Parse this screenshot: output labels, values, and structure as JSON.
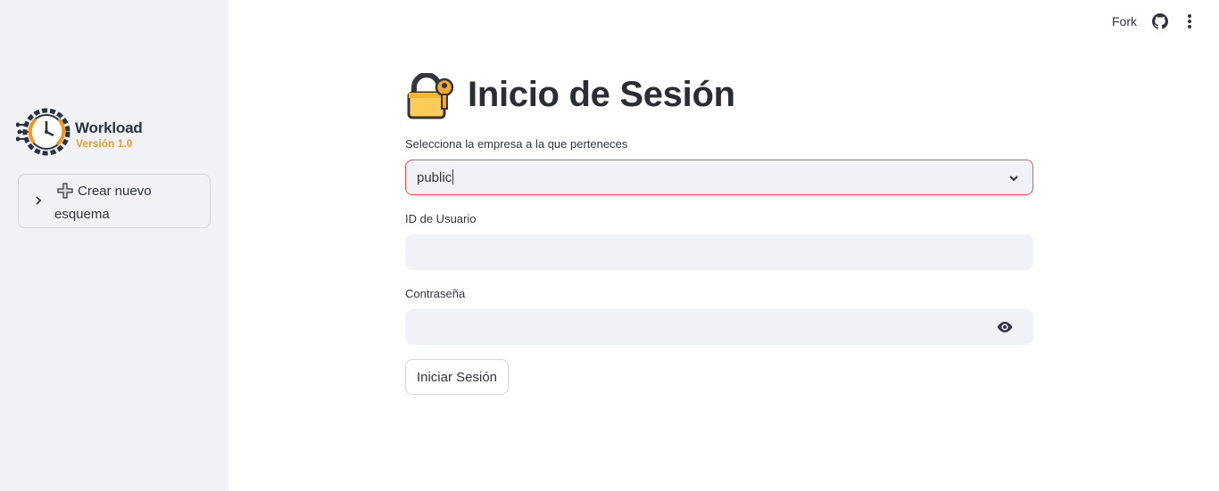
{
  "header": {
    "fork_label": "Fork",
    "github_icon": "github-icon",
    "menu_icon": "more-vertical-icon"
  },
  "sidebar": {
    "logo": {
      "title": "Workload",
      "subtitle": "Versión 1.0",
      "icon": "clock-gear-icon"
    },
    "expander": {
      "label": "Crear nuevo esquema",
      "icon": "plus-icon",
      "chevron_icon": "chevron-right-icon"
    }
  },
  "main": {
    "title": "Inicio de Sesión",
    "title_icon": "lock-with-key-icon",
    "company_label": "Selecciona la empresa a la que perteneces",
    "company_value": "public",
    "user_label": "ID de Usuario",
    "user_value": "",
    "password_label": "Contraseña",
    "password_value": "",
    "submit_label": "Iniciar Sesión"
  },
  "colors": {
    "accent": "#ff4b4b",
    "sidebar_bg": "#f0f2f6",
    "logo_orange": "#f29a1f",
    "logo_dark": "#2b3340"
  }
}
